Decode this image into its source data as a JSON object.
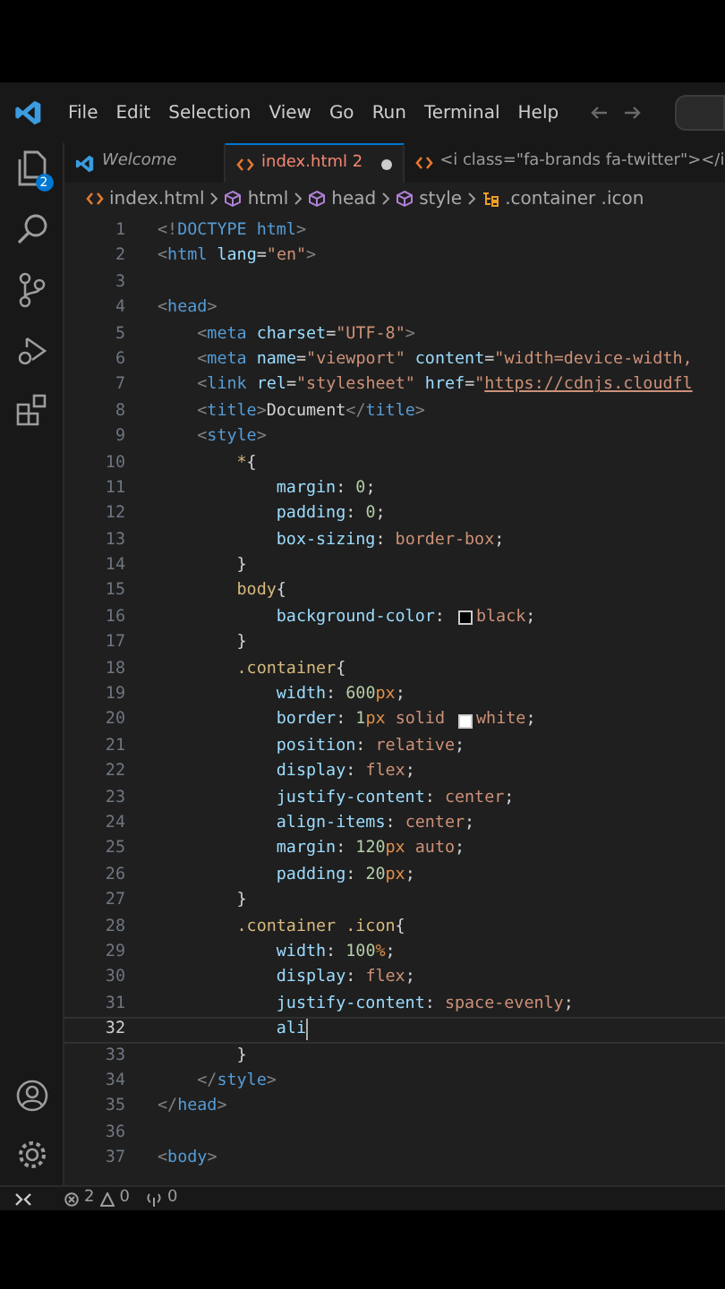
{
  "menu_bar": {
    "items": [
      "File",
      "Edit",
      "Selection",
      "View",
      "Go",
      "Run",
      "Terminal",
      "Help"
    ]
  },
  "activity_bar": {
    "explorer_badge": "2"
  },
  "tabs": [
    {
      "label": "Welcome",
      "selected": false,
      "modified": false
    },
    {
      "label": "index.html 2",
      "selected": true,
      "modified": true
    },
    {
      "label": "<i class=\"fa-brands fa-twitter\"></i",
      "selected": false,
      "modified": false
    }
  ],
  "breadcrumbs": [
    "index.html",
    "html",
    "head",
    "style",
    ".container .icon"
  ],
  "editor": {
    "lines": [
      {
        "number": "1",
        "active": false,
        "tokens": [
          {
            "kind": "punct",
            "text": "<!"
          },
          {
            "kind": "tag",
            "text": "DOCTYPE html"
          },
          {
            "kind": "punct",
            "text": ">"
          }
        ]
      },
      {
        "number": "2",
        "active": false,
        "tokens": [
          {
            "kind": "punct",
            "text": "<"
          },
          {
            "kind": "tag",
            "text": "html"
          },
          {
            "kind": "attr",
            "text": " lang"
          },
          {
            "kind": "plain",
            "text": "="
          },
          {
            "kind": "str",
            "text": "\"en\""
          },
          {
            "kind": "punct",
            "text": ">"
          }
        ]
      },
      {
        "number": "3",
        "active": false
      },
      {
        "number": "4",
        "active": false,
        "tokens": [
          {
            "kind": "punct",
            "text": "<"
          },
          {
            "kind": "tag",
            "text": "head"
          },
          {
            "kind": "punct",
            "text": ">"
          }
        ]
      },
      {
        "number": "5",
        "active": false,
        "tokens": [
          {
            "kind": "punct",
            "text": "    <"
          },
          {
            "kind": "tag",
            "text": "meta"
          },
          {
            "kind": "attr",
            "text": " charset"
          },
          {
            "kind": "plain",
            "text": "="
          },
          {
            "kind": "str",
            "text": "\"UTF-8\""
          },
          {
            "kind": "punct",
            "text": ">"
          }
        ]
      },
      {
        "number": "6",
        "active": false,
        "tokens": [
          {
            "kind": "punct",
            "text": "    <"
          },
          {
            "kind": "tag",
            "text": "meta"
          },
          {
            "kind": "attr",
            "text": " name"
          },
          {
            "kind": "plain",
            "text": "="
          },
          {
            "kind": "str",
            "text": "\"viewport\""
          },
          {
            "kind": "attr",
            "text": " content"
          },
          {
            "kind": "plain",
            "text": "="
          },
          {
            "kind": "str",
            "text": "\"width=device-width,"
          }
        ]
      },
      {
        "number": "7",
        "active": false,
        "tokens": [
          {
            "kind": "punct",
            "text": "    <"
          },
          {
            "kind": "tag",
            "text": "link"
          },
          {
            "kind": "attr",
            "text": " rel"
          },
          {
            "kind": "plain",
            "text": "="
          },
          {
            "kind": "str",
            "text": "\"stylesheet\""
          },
          {
            "kind": "attr",
            "text": " href"
          },
          {
            "kind": "plain",
            "text": "="
          },
          {
            "kind": "str",
            "text": "\""
          },
          {
            "kind": "link",
            "text": "https://cdnjs.cloudfl"
          }
        ]
      },
      {
        "number": "8",
        "active": false,
        "tokens": [
          {
            "kind": "punct",
            "text": "    <"
          },
          {
            "kind": "tag",
            "text": "title"
          },
          {
            "kind": "punct",
            "text": ">"
          },
          {
            "kind": "plain",
            "text": "Document"
          },
          {
            "kind": "punct",
            "text": "</"
          },
          {
            "kind": "tag",
            "text": "title"
          },
          {
            "kind": "punct",
            "text": ">"
          }
        ]
      },
      {
        "number": "9",
        "active": false,
        "tokens": [
          {
            "kind": "punct",
            "text": "    <"
          },
          {
            "kind": "tag",
            "text": "style"
          },
          {
            "kind": "punct",
            "text": ">"
          }
        ]
      },
      {
        "number": "10",
        "active": false,
        "tokens": [
          {
            "kind": "selector",
            "text": "        *"
          },
          {
            "kind": "plain",
            "text": "{"
          }
        ]
      },
      {
        "number": "11",
        "active": false,
        "tokens": [
          {
            "kind": "prop",
            "text": "            margin"
          },
          {
            "kind": "plain",
            "text": ": "
          },
          {
            "kind": "num",
            "text": "0"
          },
          {
            "kind": "plain",
            "text": ";"
          }
        ]
      },
      {
        "number": "12",
        "active": false,
        "tokens": [
          {
            "kind": "prop",
            "text": "            padding"
          },
          {
            "kind": "plain",
            "text": ": "
          },
          {
            "kind": "num",
            "text": "0"
          },
          {
            "kind": "plain",
            "text": ";"
          }
        ]
      },
      {
        "number": "13",
        "active": false,
        "tokens": [
          {
            "kind": "prop",
            "text": "            box-sizing"
          },
          {
            "kind": "plain",
            "text": ": "
          },
          {
            "kind": "value",
            "text": "border-box"
          },
          {
            "kind": "plain",
            "text": ";"
          }
        ]
      },
      {
        "number": "14",
        "active": false,
        "tokens": [
          {
            "kind": "plain",
            "text": "        }"
          }
        ]
      },
      {
        "number": "15",
        "active": false,
        "tokens": [
          {
            "kind": "selector",
            "text": "        body"
          },
          {
            "kind": "plain",
            "text": "{"
          }
        ]
      },
      {
        "number": "16",
        "active": false,
        "tokens": [
          {
            "kind": "prop",
            "text": "            background-color"
          },
          {
            "kind": "plain",
            "text": ": "
          },
          {
            "kind": "swatch",
            "color": "#000000"
          },
          {
            "kind": "value",
            "text": "black"
          },
          {
            "kind": "plain",
            "text": ";"
          }
        ]
      },
      {
        "number": "17",
        "active": false,
        "tokens": [
          {
            "kind": "plain",
            "text": "        }"
          }
        ]
      },
      {
        "number": "18",
        "active": false,
        "tokens": [
          {
            "kind": "selector",
            "text": "        .container"
          },
          {
            "kind": "plain",
            "text": "{"
          }
        ]
      },
      {
        "number": "19",
        "active": false,
        "tokens": [
          {
            "kind": "prop",
            "text": "            width"
          },
          {
            "kind": "plain",
            "text": ": "
          },
          {
            "kind": "num",
            "text": "600"
          },
          {
            "kind": "unit",
            "text": "px"
          },
          {
            "kind": "plain",
            "text": ";"
          }
        ]
      },
      {
        "number": "20",
        "active": false,
        "tokens": [
          {
            "kind": "prop",
            "text": "            border"
          },
          {
            "kind": "plain",
            "text": ": "
          },
          {
            "kind": "num",
            "text": "1"
          },
          {
            "kind": "unit",
            "text": "px"
          },
          {
            "kind": "value",
            "text": " solid "
          },
          {
            "kind": "swatch",
            "color": "#ffffff"
          },
          {
            "kind": "value",
            "text": "white"
          },
          {
            "kind": "plain",
            "text": ";"
          }
        ]
      },
      {
        "number": "21",
        "active": false,
        "tokens": [
          {
            "kind": "prop",
            "text": "            position"
          },
          {
            "kind": "plain",
            "text": ": "
          },
          {
            "kind": "value",
            "text": "relative"
          },
          {
            "kind": "plain",
            "text": ";"
          }
        ]
      },
      {
        "number": "22",
        "active": false,
        "tokens": [
          {
            "kind": "prop",
            "text": "            display"
          },
          {
            "kind": "plain",
            "text": ": "
          },
          {
            "kind": "value",
            "text": "flex"
          },
          {
            "kind": "plain",
            "text": ";"
          }
        ]
      },
      {
        "number": "23",
        "active": false,
        "tokens": [
          {
            "kind": "prop",
            "text": "            justify-content"
          },
          {
            "kind": "plain",
            "text": ": "
          },
          {
            "kind": "value",
            "text": "center"
          },
          {
            "kind": "plain",
            "text": ";"
          }
        ]
      },
      {
        "number": "24",
        "active": false,
        "tokens": [
          {
            "kind": "prop",
            "text": "            align-items"
          },
          {
            "kind": "plain",
            "text": ": "
          },
          {
            "kind": "value",
            "text": "center"
          },
          {
            "kind": "plain",
            "text": ";"
          }
        ]
      },
      {
        "number": "25",
        "active": false,
        "tokens": [
          {
            "kind": "prop",
            "text": "            margin"
          },
          {
            "kind": "plain",
            "text": ": "
          },
          {
            "kind": "num",
            "text": "120"
          },
          {
            "kind": "unit",
            "text": "px"
          },
          {
            "kind": "value",
            "text": " auto"
          },
          {
            "kind": "plain",
            "text": ";"
          }
        ]
      },
      {
        "number": "26",
        "active": false,
        "tokens": [
          {
            "kind": "prop",
            "text": "            padding"
          },
          {
            "kind": "plain",
            "text": ": "
          },
          {
            "kind": "num",
            "text": "20"
          },
          {
            "kind": "unit",
            "text": "px"
          },
          {
            "kind": "plain",
            "text": ";"
          }
        ]
      },
      {
        "number": "27",
        "active": false,
        "tokens": [
          {
            "kind": "plain",
            "text": "        }"
          }
        ]
      },
      {
        "number": "28",
        "active": false,
        "tokens": [
          {
            "kind": "selector",
            "text": "        .container .icon"
          },
          {
            "kind": "plain",
            "text": "{"
          }
        ]
      },
      {
        "number": "29",
        "active": false,
        "tokens": [
          {
            "kind": "prop",
            "text": "            width"
          },
          {
            "kind": "plain",
            "text": ": "
          },
          {
            "kind": "num",
            "text": "100"
          },
          {
            "kind": "unit",
            "text": "%"
          },
          {
            "kind": "plain",
            "text": ";"
          }
        ]
      },
      {
        "number": "30",
        "active": false,
        "tokens": [
          {
            "kind": "prop",
            "text": "            display"
          },
          {
            "kind": "plain",
            "text": ": "
          },
          {
            "kind": "value",
            "text": "flex"
          },
          {
            "kind": "plain",
            "text": ";"
          }
        ]
      },
      {
        "number": "31",
        "active": false,
        "tokens": [
          {
            "kind": "prop",
            "text": "            justify-content"
          },
          {
            "kind": "plain",
            "text": ": "
          },
          {
            "kind": "value",
            "text": "space-evenly"
          },
          {
            "kind": "plain",
            "text": ";"
          }
        ]
      },
      {
        "number": "32",
        "active": true,
        "tokens": [
          {
            "kind": "prop",
            "text": "            ali"
          }
        ]
      },
      {
        "number": "33",
        "active": false,
        "tokens": [
          {
            "kind": "plain",
            "text": "        }"
          }
        ]
      },
      {
        "number": "34",
        "active": false,
        "tokens": [
          {
            "kind": "punct",
            "text": "    </"
          },
          {
            "kind": "tag",
            "text": "style"
          },
          {
            "kind": "punct",
            "text": ">"
          }
        ]
      },
      {
        "number": "35",
        "active": false,
        "tokens": [
          {
            "kind": "punct",
            "text": "</"
          },
          {
            "kind": "tag",
            "text": "head"
          },
          {
            "kind": "punct",
            "text": ">"
          }
        ]
      },
      {
        "number": "36",
        "active": false
      },
      {
        "number": "37",
        "active": false,
        "tokens": [
          {
            "kind": "punct",
            "text": "<"
          },
          {
            "kind": "tag",
            "text": "body"
          },
          {
            "kind": "punct",
            "text": ">"
          }
        ]
      }
    ]
  },
  "status_bar": {
    "errors": "2",
    "warnings": "0",
    "ports": "0"
  }
}
